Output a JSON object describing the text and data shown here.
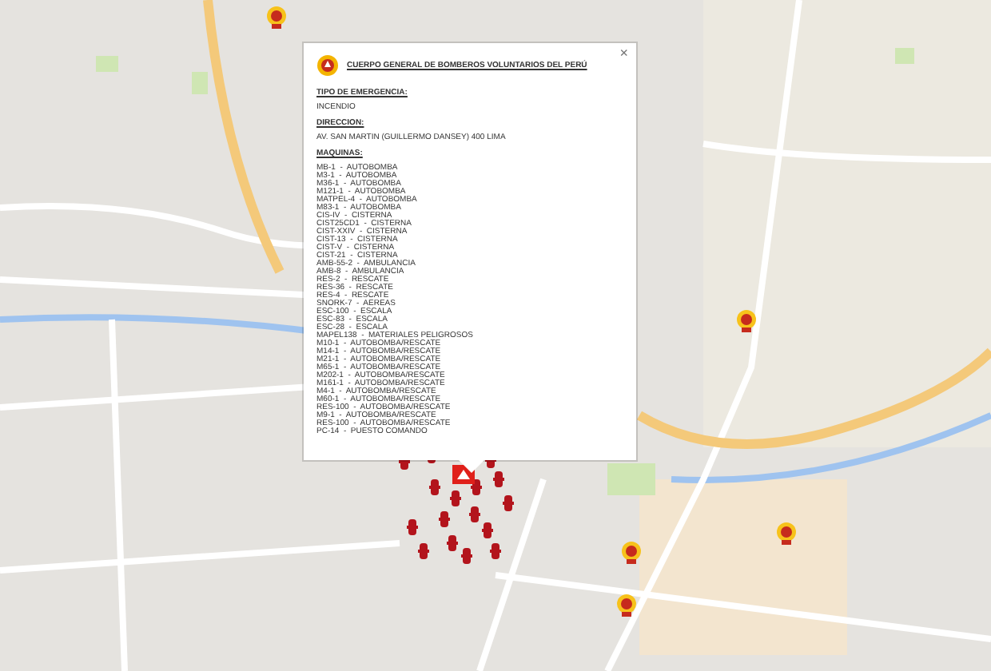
{
  "popup": {
    "close": "×",
    "title": "CUERPO GENERAL DE BOMBEROS VOLUNTARIOS DEL PERÚ",
    "sections": [
      {
        "kind": "text",
        "label": "TIPO DE EMERGENCIA:",
        "value": "INCENDIO"
      },
      {
        "kind": "text",
        "label": "DIRECCION:",
        "value": "AV. SAN MARTIN (GUILLERMO DANSEY) 400 LIMA"
      },
      {
        "kind": "list",
        "label": "MAQUINAS:",
        "items": [
          "MB-1  -  AUTOBOMBA",
          "M3-1  -  AUTOBOMBA",
          "M36-1  -  AUTOBOMBA",
          "M121-1  -  AUTOBOMBA",
          "MATPEL-4  -  AUTOBOMBA",
          "M83-1  -  AUTOBOMBA",
          "CIS-IV  -  CISTERNA",
          "CIST25CD1  -  CISTERNA",
          "CIST-XXIV  -  CISTERNA",
          "CIST-13  -  CISTERNA",
          "CIST-V  -  CISTERNA",
          "CIST-21  -  CISTERNA",
          "AMB-55-2  -  AMBULANCIA",
          "AMB-8  -  AMBULANCIA",
          "RES-2  -  RESCATE",
          "RES-36  -  RESCATE",
          "RES-4  -  RESCATE",
          "SNORK-7  -  AEREAS",
          "ESC-100  -  ESCALA",
          "ESC-83  -  ESCALA",
          "ESC-28  -  ESCALA",
          "MAPEL138  -  MATERIALES PELIGROSOS",
          "M10-1  -  AUTOBOMBA/RESCATE",
          "M14-1  -  AUTOBOMBA/RESCATE",
          "M21-1  -  AUTOBOMBA/RESCATE",
          "M65-1  -  AUTOBOMBA/RESCATE",
          "M202-1  -  AUTOBOMBA/RESCATE",
          "M161-1  -  AUTOBOMBA/RESCATE",
          "M4-1  -  AUTOBOMBA/RESCATE",
          "M60-1  -  AUTOBOMBA/RESCATE",
          "RES-100  -  AUTOBOMBA/RESCATE",
          "M9-1  -  AUTOBOMBA/RESCATE",
          "RES-100  -  AUTOBOMBA/RESCATE",
          "PC-14  -  PUESTO COMANDO"
        ]
      }
    ]
  }
}
